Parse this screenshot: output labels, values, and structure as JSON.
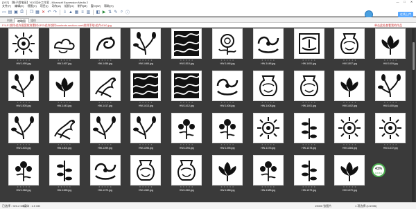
{
  "window": {
    "title": "[DST] 【帐子简笔画】YDG设计工作室 - Microsoft Expression Media 2",
    "controls": [
      "—",
      "□",
      "✕"
    ]
  },
  "menu": [
    "文件(F)",
    "编辑(E)",
    "视图(V)",
    "项目(I)",
    "动作(A)",
    "组织(O)",
    "制作(M)",
    "窗口(W)",
    "帮助(H)"
  ],
  "toolbar": {
    "badge_label": "在线上传",
    "icons": [
      "new-icon",
      "open-icon",
      "save-icon",
      "print-icon",
      "copy-icon",
      "paste-icon",
      "delete-icon",
      "undo-icon",
      "redo-icon",
      "import-icon",
      "lock-icon",
      "grid-view-icon",
      "list-view-icon",
      "light-table-icon",
      "media-view-icon",
      "slideshow-icon",
      "sort-icon",
      "edit-icon",
      "zoom-icon",
      "info-icon"
    ]
  },
  "tabs": [
    "列表",
    "缩略图",
    "媒体"
  ],
  "pathbar": {
    "path": "F:\\1P 纹样\\花卉图案纹样素材\\JPG\\花卉纹样\\contents.section.com\\纹样手绘\\花卉\\01\\0.jpg",
    "hint": "单击此处查看我的作品"
  },
  "thumbnails": [
    {
      "name": "HW-1495.jpg",
      "shape": "sun"
    },
    {
      "name": "HW-1497.jpg",
      "shape": "cloud"
    },
    {
      "name": "HW-1456.jpg",
      "shape": "dragon"
    },
    {
      "name": "HW-1466.jpg",
      "shape": "branch"
    },
    {
      "name": "HW-1510.jpg",
      "shape": "dense"
    },
    {
      "name": "HW-1446.jpg",
      "shape": "peony"
    },
    {
      "name": "HW-1448.jpg",
      "shape": "scroll"
    },
    {
      "name": "HW-1451.jpg",
      "shape": "bracket"
    },
    {
      "name": "HW-1507.jpg",
      "shape": "vase"
    },
    {
      "name": "HW-1419.jpg",
      "shape": "lotus"
    },
    {
      "name": "HW-1505.jpg",
      "shape": "branch"
    },
    {
      "name": "HW-1443.jpg",
      "shape": "lotus"
    },
    {
      "name": "HW-1417.jpg",
      "shape": "phoenix"
    },
    {
      "name": "HW-1413.jpg",
      "shape": "dense"
    },
    {
      "name": "HW-1412.jpg",
      "shape": "dense"
    },
    {
      "name": "HW-1406.jpg",
      "shape": "scroll"
    },
    {
      "name": "HW-1408.jpg",
      "shape": "vase"
    },
    {
      "name": "HW-1401.jpg",
      "shape": "vase"
    },
    {
      "name": "HW-1402.jpg",
      "shape": "lotus"
    },
    {
      "name": "HW-1400.jpg",
      "shape": "branch"
    },
    {
      "name": "HW-1403.jpg",
      "shape": "branch"
    },
    {
      "name": "HW-1401.jpg",
      "shape": "phoenix"
    },
    {
      "name": "HW-1399.jpg",
      "shape": "branch"
    },
    {
      "name": "HW-1396.jpg",
      "shape": "branch"
    },
    {
      "name": "HW-1394.jpg",
      "shape": "flower"
    },
    {
      "name": "HW-1395.jpg",
      "shape": "flower"
    },
    {
      "name": "HW-1376.jpg",
      "shape": "sun"
    },
    {
      "name": "HW-1378.jpg",
      "shape": "stalk"
    },
    {
      "name": "HW-1384.jpg",
      "shape": "sun"
    },
    {
      "name": "HW-1372.jpg",
      "shape": "sun"
    },
    {
      "name": "HW-1368.jpg",
      "shape": "flower"
    },
    {
      "name": "HW-1365.jpg",
      "shape": "stalk"
    },
    {
      "name": "HW-1373.jpg",
      "shape": "scroll"
    },
    {
      "name": "HW-1382.jpg",
      "shape": "vase"
    },
    {
      "name": "HW-1360.jpg",
      "shape": "vase"
    },
    {
      "name": "HW-1388.jpg",
      "shape": "lotus"
    },
    {
      "name": "HW-1385.jpg",
      "shape": "flower"
    },
    {
      "name": "HW-1379.jpg",
      "shape": "stalk"
    },
    {
      "name": "HW-1370.jpg",
      "shape": "lotus"
    }
  ],
  "progress": {
    "percent": "41%",
    "rate": "0.01K/s"
  },
  "status": {
    "selection": "已选择 : 923.2 MB",
    "size": "媒体 : 1.5 GB",
    "count": "19000 张图片",
    "page": "1 项选择 (1/1935)"
  },
  "colors": {
    "grid_bg": "#3a3a3a",
    "accent": "#5aa9ff",
    "path_text": "#cc3333",
    "progress": "#4caf50"
  }
}
